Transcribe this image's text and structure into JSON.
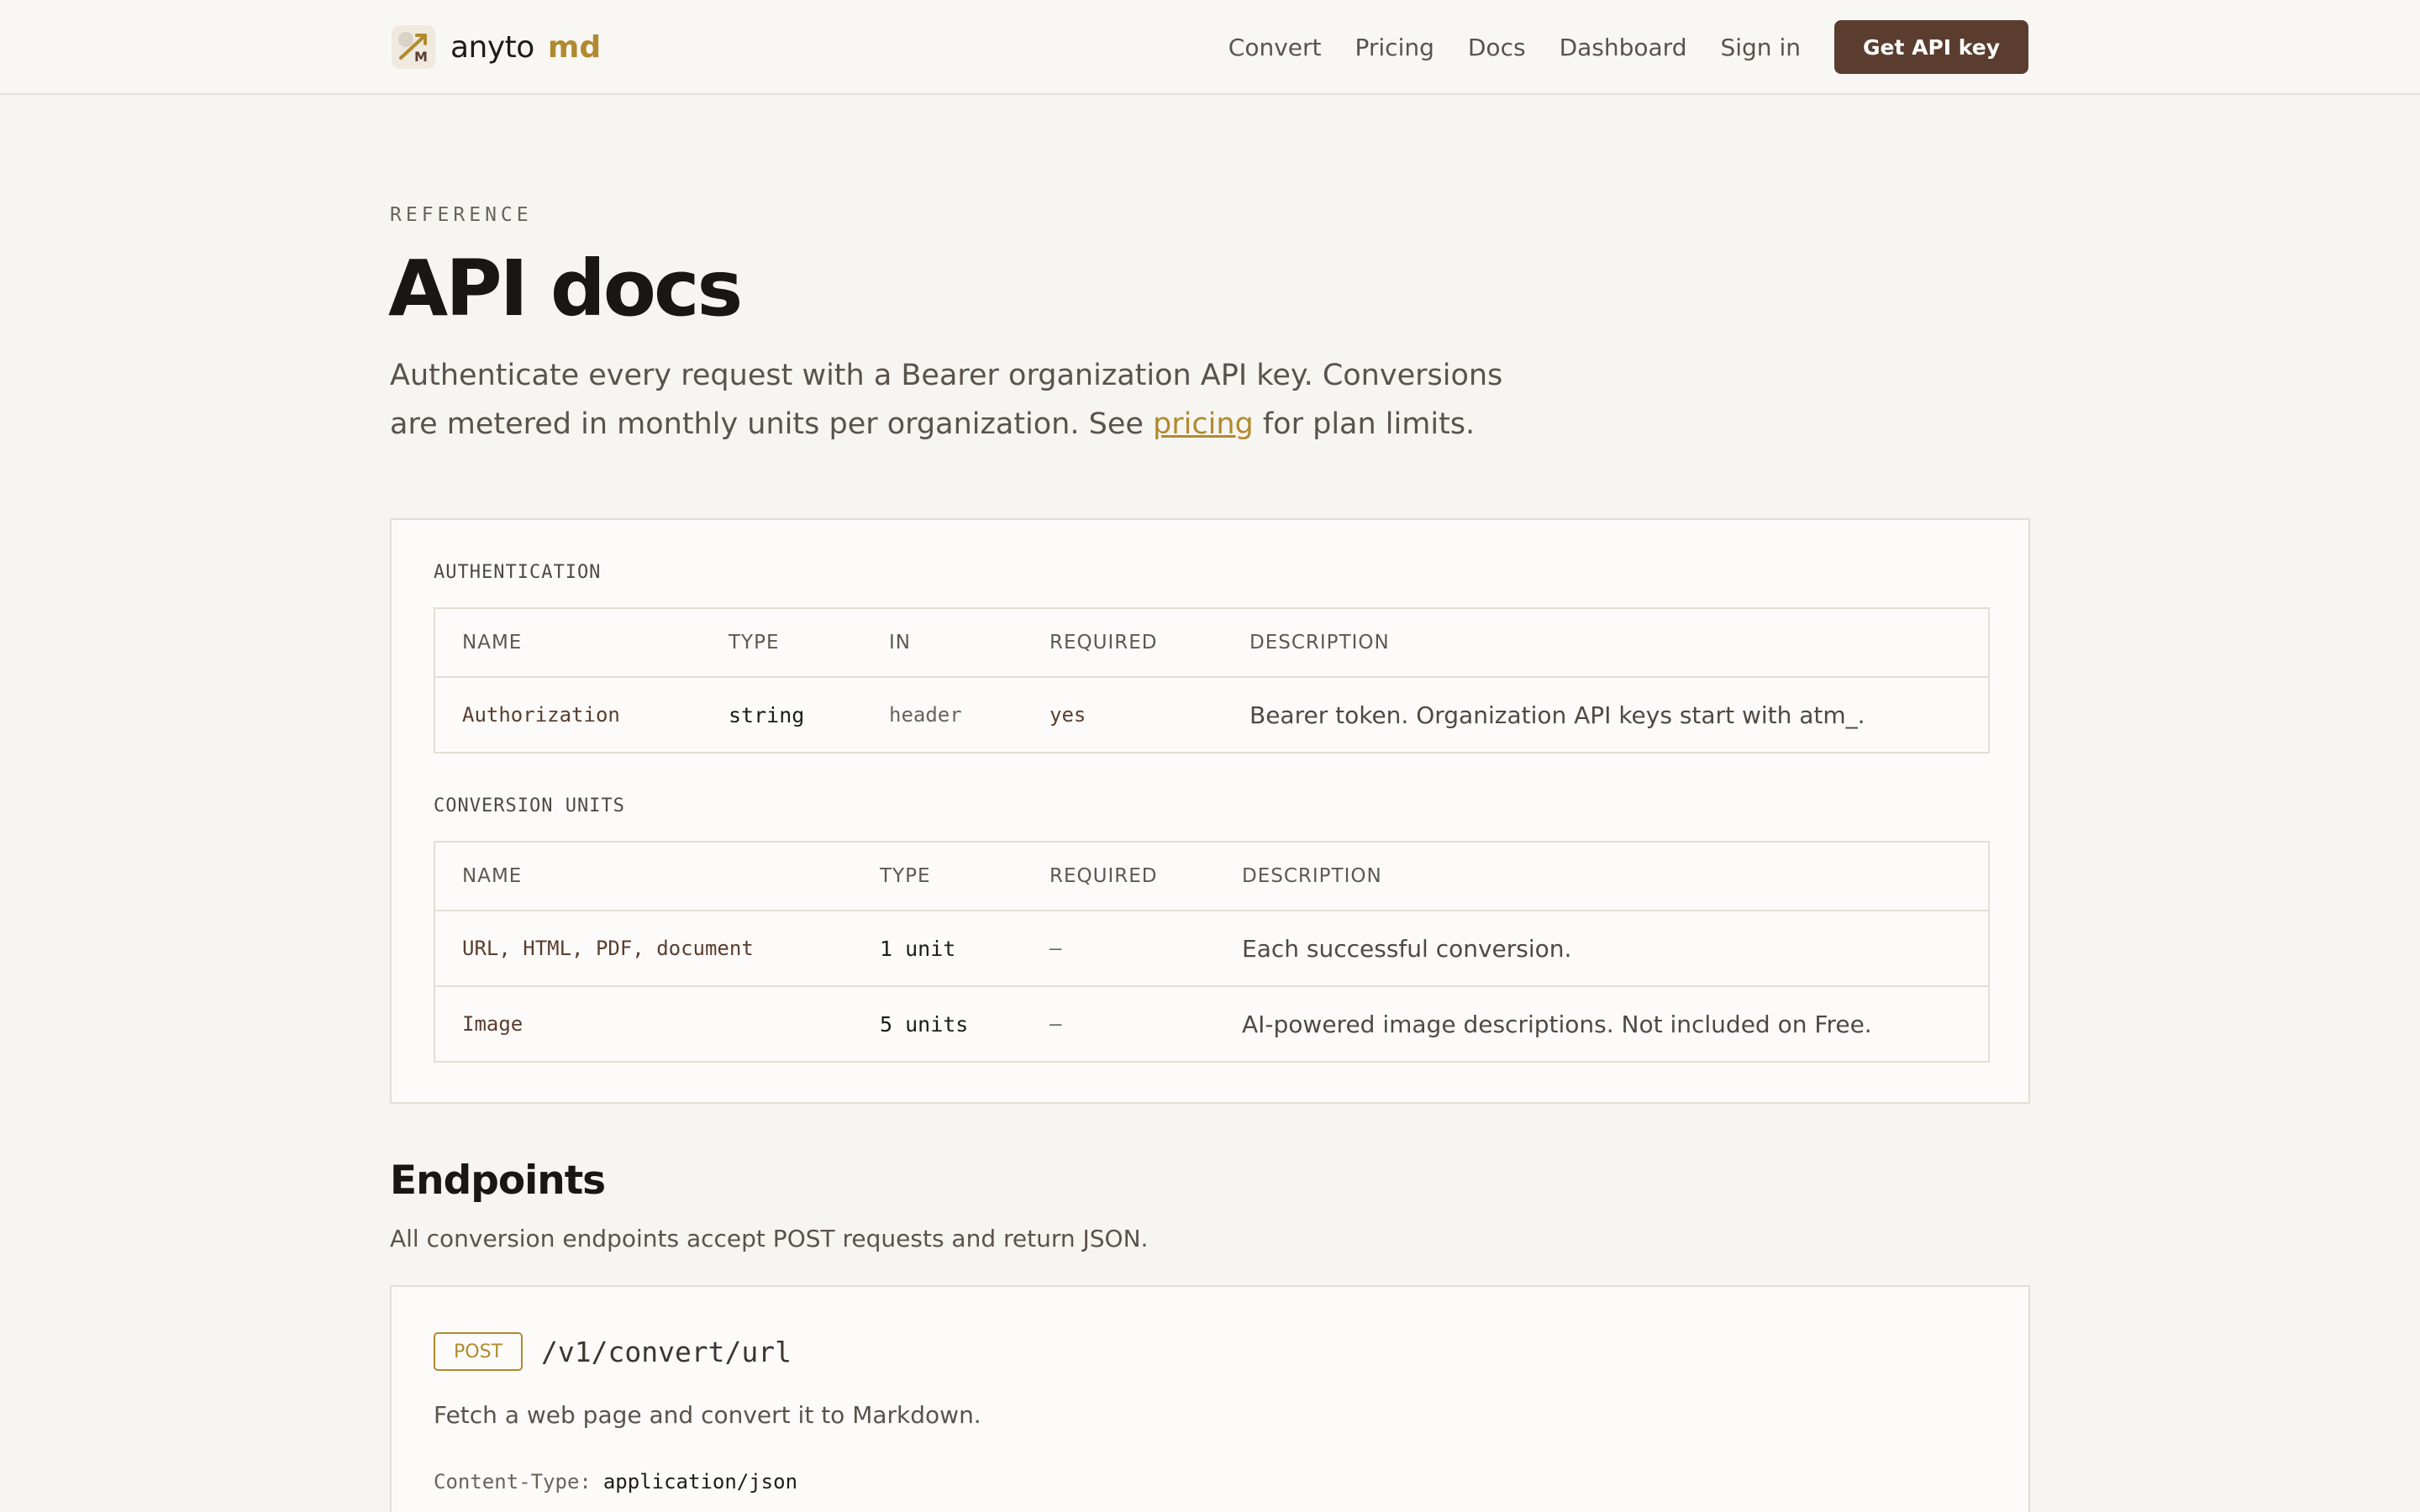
{
  "nav": {
    "brand_name": "anyto",
    "brand_accent": "md",
    "logo_icon": "arrow-logo-icon",
    "links": [
      "Convert",
      "Pricing",
      "Docs",
      "Dashboard",
      "Sign in"
    ],
    "cta": "Get API key"
  },
  "hero": {
    "eyebrow": "REFERENCE",
    "title": "API docs",
    "lead_before": "Authenticate every request with a Bearer organization API key. Conversions are metered in monthly units per organization. See ",
    "lead_link": "pricing",
    "lead_after": " for plan limits."
  },
  "auth": {
    "label": "AUTHENTICATION",
    "headers": [
      "NAME",
      "TYPE",
      "IN",
      "REQUIRED",
      "DESCRIPTION"
    ],
    "rows": [
      {
        "name": "Authorization",
        "type": "string",
        "in": "header",
        "required": "yes",
        "description": "Bearer token. Organization API keys start with atm_."
      }
    ]
  },
  "units": {
    "label": "CONVERSION UNITS",
    "headers": [
      "NAME",
      "TYPE",
      "REQUIRED",
      "DESCRIPTION"
    ],
    "rows": [
      {
        "name": "URL, HTML, PDF, document",
        "type": "1 unit",
        "required": "–",
        "description": "Each successful conversion."
      },
      {
        "name": "Image",
        "type": "5 units",
        "required": "–",
        "description": "AI-powered image descriptions. Not included on Free."
      }
    ]
  },
  "endpoints": {
    "title": "Endpoints",
    "subtitle": "All conversion endpoints accept POST requests and return JSON.",
    "items": [
      {
        "method": "POST",
        "path": "/v1/convert/url",
        "description": "Fetch a web page and convert it to Markdown.",
        "header_key": "Content-Type:",
        "header_value": "application/json"
      }
    ]
  },
  "colors": {
    "accent": "#b08a2e",
    "brand_button": "#5a3d2e",
    "background": "#f7f5f1"
  }
}
